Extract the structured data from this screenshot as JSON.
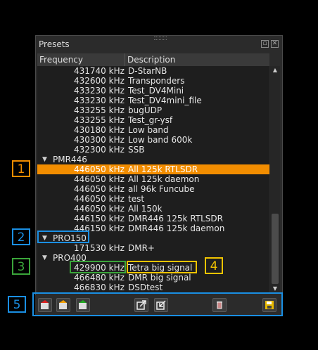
{
  "panel": {
    "title": "Presets",
    "float_icon": "float-icon",
    "close_icon": "close-icon"
  },
  "columns": {
    "frequency": "Frequency",
    "description": "Description"
  },
  "rows_top": [
    {
      "freq": "431740 kHz",
      "desc": "D-StarNB"
    },
    {
      "freq": "432600 kHz",
      "desc": "Transponders"
    },
    {
      "freq": "433230 kHz",
      "desc": "Test_DV4Mini"
    },
    {
      "freq": "433230 kHz",
      "desc": "Test_DV4mini_file"
    },
    {
      "freq": "433255 kHz",
      "desc": "bugUDP"
    },
    {
      "freq": "433255 kHz",
      "desc": "Test_gr-ysf"
    },
    {
      "freq": "430180 kHz",
      "desc": "Low band"
    },
    {
      "freq": "430300 kHz",
      "desc": "Low band 600k"
    },
    {
      "freq": "432300 kHz",
      "desc": "SSB"
    }
  ],
  "groups": {
    "pmr446": "PMR446",
    "pro150": "PRO150",
    "pro400": "PRO400"
  },
  "rows_pmr446": [
    {
      "freq": "446050 kHz",
      "desc": "All 125k RTLSDR",
      "selected": true
    },
    {
      "freq": "446050 kHz",
      "desc": "All 125k daemon"
    },
    {
      "freq": "446050 kHz",
      "desc": "all 96k Funcube"
    },
    {
      "freq": "446050 kHz",
      "desc": "test"
    },
    {
      "freq": "446050 kHz",
      "desc": "All 150k"
    },
    {
      "freq": "446150 kHz",
      "desc": "DMR446 125k RTLSDR"
    },
    {
      "freq": "446150 kHz",
      "desc": "DMR446 125k daemon"
    }
  ],
  "rows_pro150": [
    {
      "freq": "171530 kHz",
      "desc": "DMR+"
    }
  ],
  "rows_pro400": [
    {
      "freq": "429900 kHz",
      "desc": "Tetra big signal"
    },
    {
      "freq": "466480 kHz",
      "desc": "DMR big signal"
    },
    {
      "freq": "466830 kHz",
      "desc": "DSDtest"
    }
  ],
  "callouts": {
    "c1": "1",
    "c2": "2",
    "c3": "3",
    "c4": "4",
    "c5": "5"
  },
  "colors": {
    "selection": "#f28d00",
    "blue": "#1a8fe3",
    "green": "#3aa53a",
    "yellow": "#f2c400"
  },
  "toolbar_icons": [
    "add-preset-icon",
    "update-preset-icon",
    "edit-preset-icon",
    "export-icon",
    "import-icon",
    "delete-icon",
    "load-preset-icon"
  ]
}
